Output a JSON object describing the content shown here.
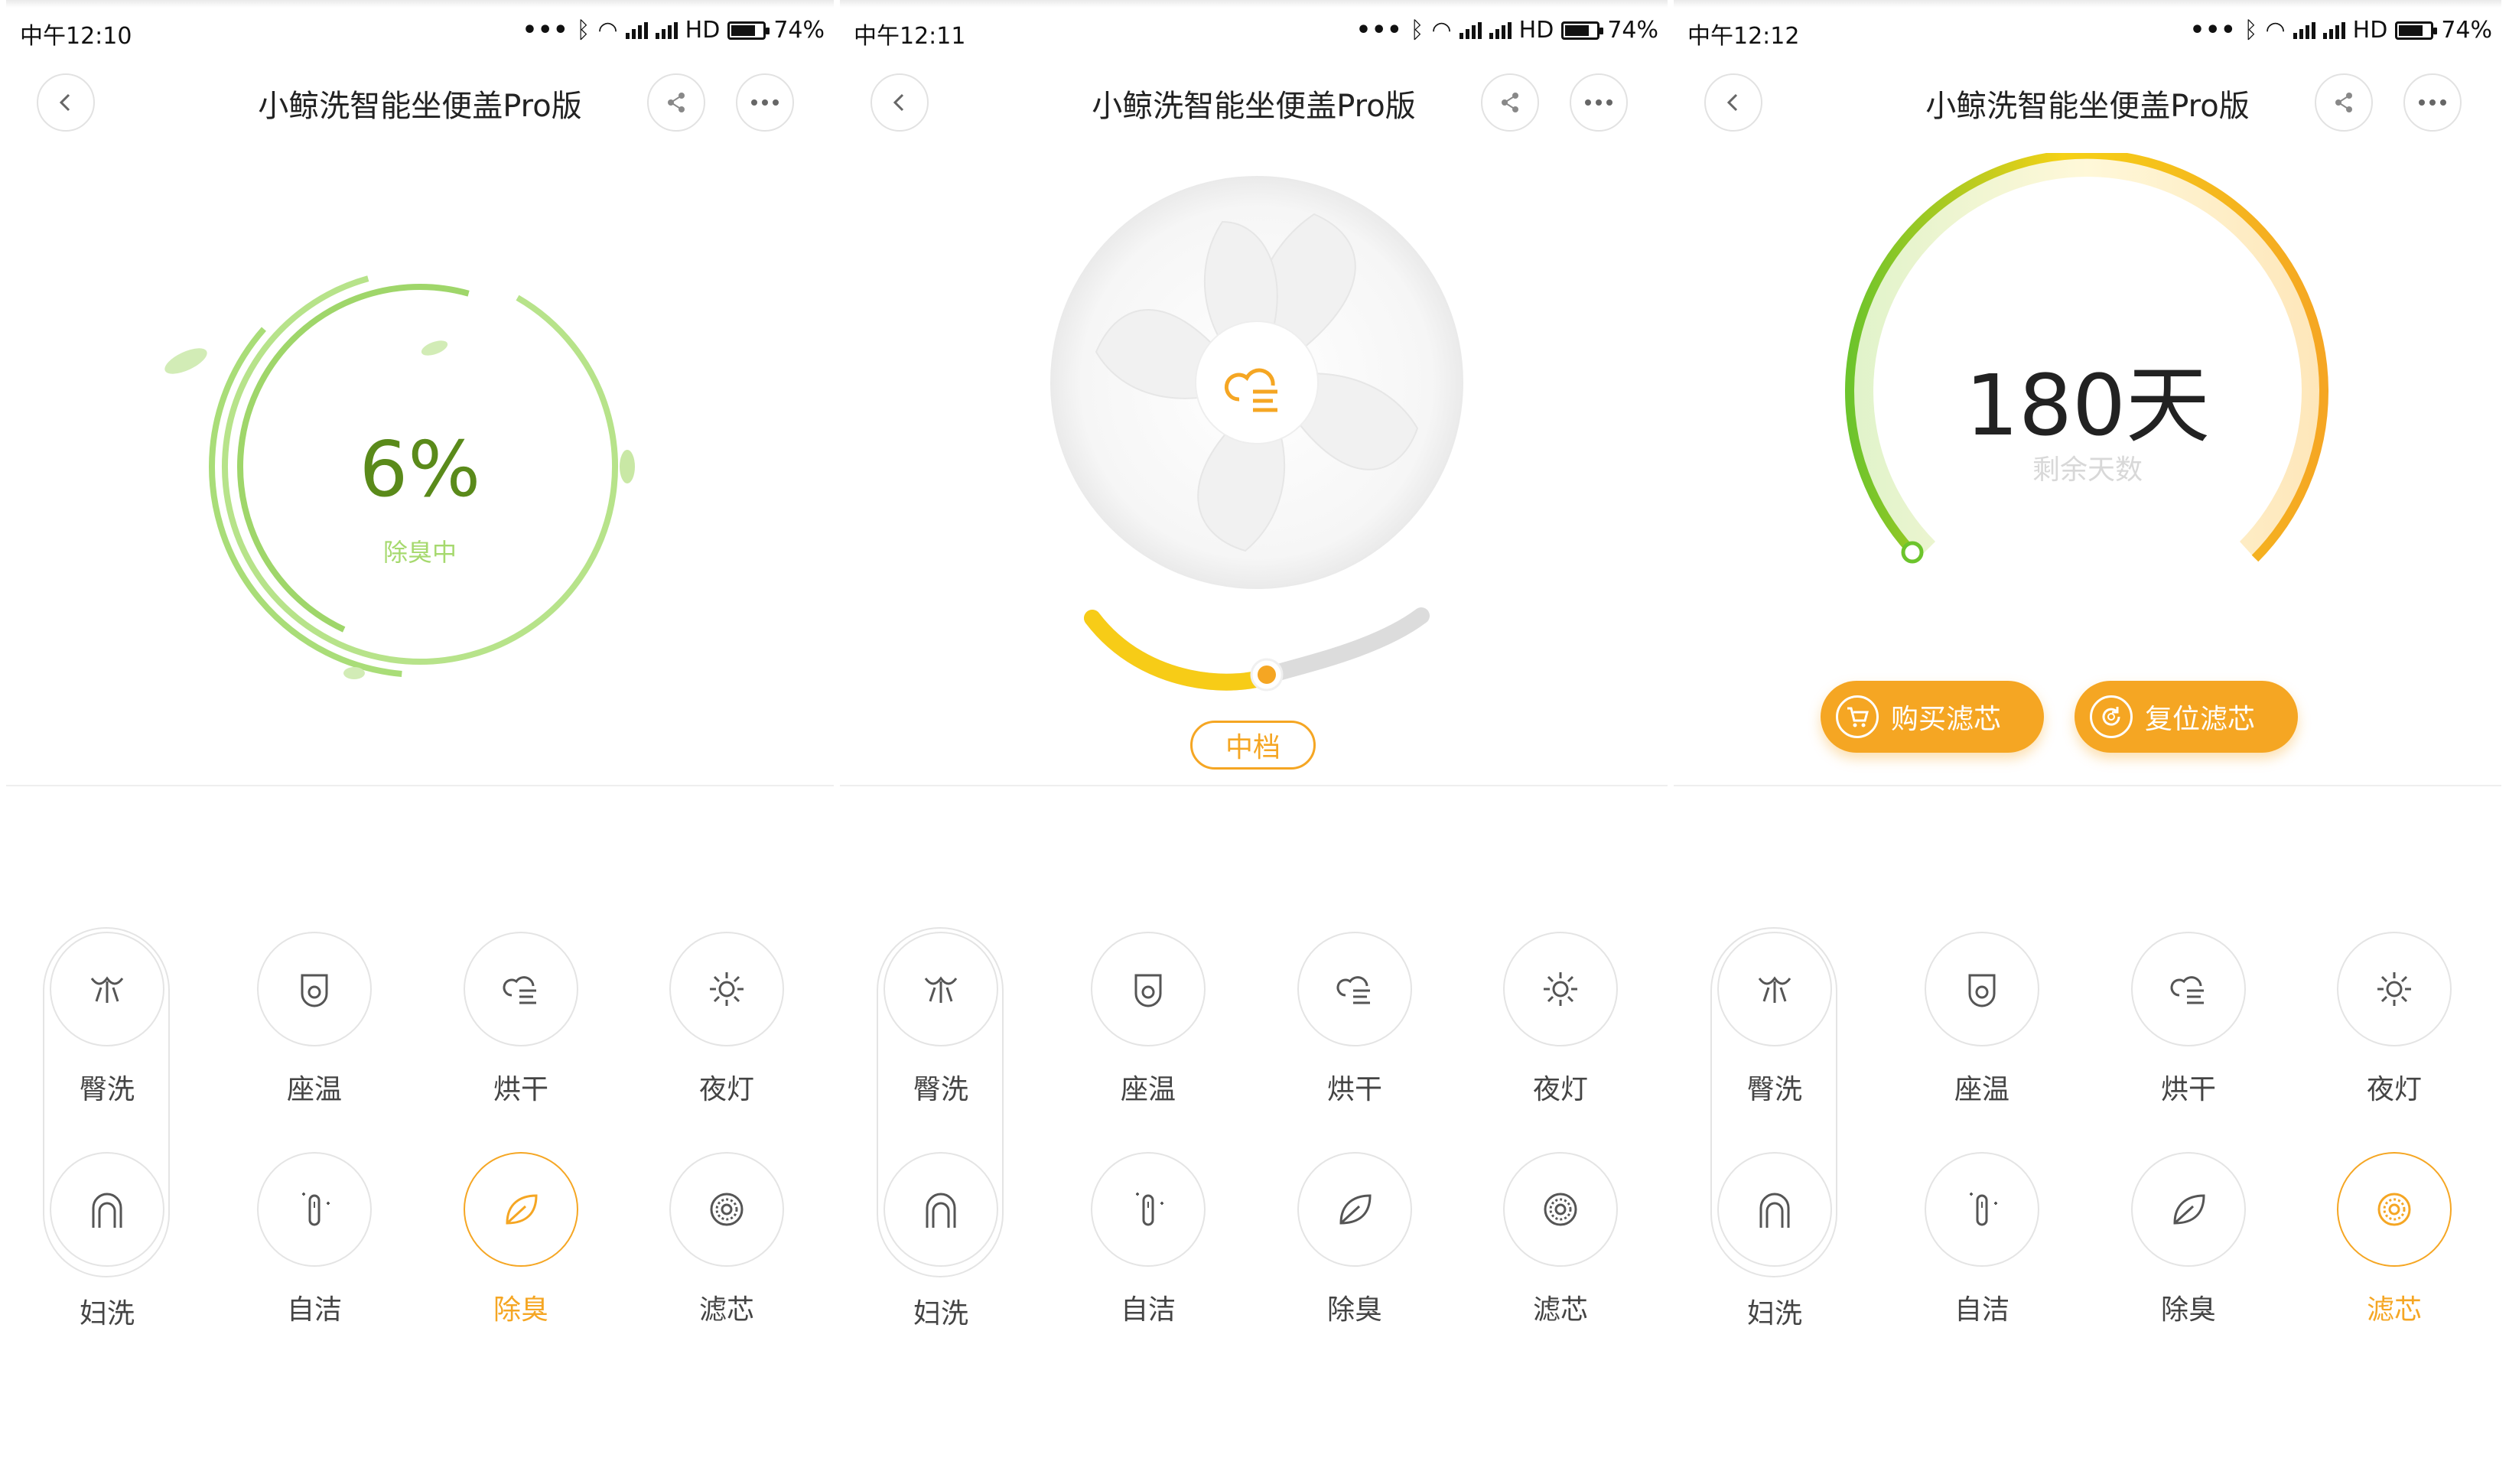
{
  "screens": [
    {
      "status": {
        "time": "中午12:10",
        "network": "HD",
        "battery": "74%"
      },
      "header": {
        "title": "小鲸洗智能坐便盖Pro版"
      },
      "hero": {
        "value": "6%",
        "caption": "除臭中"
      },
      "grid": [
        "臀洗",
        "座温",
        "烘干",
        "夜灯",
        "妇洗",
        "自洁",
        "除臭",
        "滤芯"
      ],
      "active": "除臭"
    },
    {
      "status": {
        "time": "中午12:11",
        "network": "HD",
        "battery": "74%"
      },
      "header": {
        "title": "小鲸洗智能坐便盖Pro版"
      },
      "hero": {
        "mode": "中档",
        "level": 0.5
      },
      "grid": [
        "臀洗",
        "座温",
        "烘干",
        "夜灯",
        "妇洗",
        "自洁",
        "除臭",
        "滤芯"
      ],
      "active": ""
    },
    {
      "status": {
        "time": "中午12:12",
        "network": "HD",
        "battery": "74%"
      },
      "header": {
        "title": "小鲸洗智能坐便盖Pro版"
      },
      "hero": {
        "days": "180天",
        "caption": "剩余天数",
        "buy_label": "购买滤芯",
        "reset_label": "复位滤芯"
      },
      "grid": [
        "臀洗",
        "座温",
        "烘干",
        "夜灯",
        "妇洗",
        "自洁",
        "除臭",
        "滤芯"
      ],
      "active": "滤芯"
    }
  ],
  "colors": {
    "accent": "#f5a623",
    "green": "#8fd14f",
    "green_dark": "#5a8a1a"
  },
  "icons": [
    "back-icon",
    "share-icon",
    "more-icon",
    "butt-wash-icon",
    "seat-temp-icon",
    "dry-icon",
    "night-light-icon",
    "feminine-wash-icon",
    "self-clean-icon",
    "deodorize-icon",
    "filter-icon"
  ]
}
